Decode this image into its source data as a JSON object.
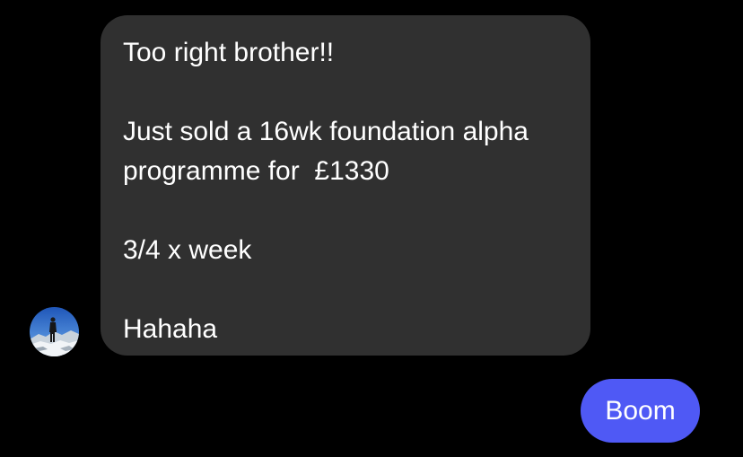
{
  "conversation": {
    "incoming_message": {
      "lines": [
        "Too right brother!!",
        "",
        "Just sold a 16wk foundation alpha",
        "programme for  £1330",
        "",
        "3/4 x week",
        "",
        "Hahaha"
      ],
      "bubble_color": "#303030"
    },
    "sender_avatar": {
      "icon": "profile-photo-snowy-mountain"
    },
    "outgoing_message": {
      "text": "Boom",
      "bubble_color": "#4f59f5"
    }
  }
}
